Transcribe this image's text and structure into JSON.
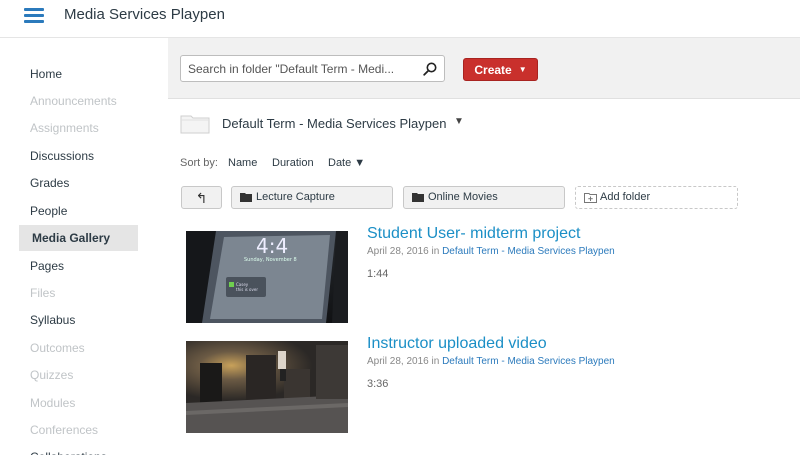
{
  "header": {
    "title": "Media Services Playpen"
  },
  "sidebar": {
    "items": [
      {
        "label": "Home",
        "state": "enabled"
      },
      {
        "label": "Announcements",
        "state": "disabled"
      },
      {
        "label": "Assignments",
        "state": "disabled"
      },
      {
        "label": "Discussions",
        "state": "enabled"
      },
      {
        "label": "Grades",
        "state": "enabled"
      },
      {
        "label": "People",
        "state": "enabled"
      },
      {
        "label": "Media Gallery",
        "state": "active"
      },
      {
        "label": "Pages",
        "state": "enabled"
      },
      {
        "label": "Files",
        "state": "disabled"
      },
      {
        "label": "Syllabus",
        "state": "enabled"
      },
      {
        "label": "Outcomes",
        "state": "disabled"
      },
      {
        "label": "Quizzes",
        "state": "disabled"
      },
      {
        "label": "Modules",
        "state": "disabled"
      },
      {
        "label": "Conferences",
        "state": "disabled"
      },
      {
        "label": "Collaborations",
        "state": "enabled"
      }
    ]
  },
  "toolbar": {
    "search_value": "Search in folder \"Default Term - Medi...",
    "create_label": "Create",
    "create_caret": "▼"
  },
  "folder": {
    "title": "Default Term - Media Services Playpen",
    "dropdown_caret": "▼"
  },
  "sort": {
    "label": "Sort by:",
    "options": [
      {
        "label": "Name"
      },
      {
        "label": "Duration"
      },
      {
        "label": "Date ▼"
      }
    ]
  },
  "folders": {
    "up_symbol": "↰",
    "items": [
      {
        "label": "Lecture Capture"
      },
      {
        "label": "Online Movies"
      }
    ],
    "add_label": "Add folder"
  },
  "media": [
    {
      "title": "Student User- midterm project",
      "date": "April 28, 2016",
      "in_word": "in",
      "folder": "Default Term - Media Services Playpen",
      "duration": "1:44",
      "thumb_text": {
        "time": "4:4",
        "date": "Sunday, November 8",
        "notif": "Casey\nthis is over"
      }
    },
    {
      "title": "Instructor uploaded video",
      "date": "April 28, 2016",
      "in_word": "in",
      "folder": "Default Term - Media Services Playpen",
      "duration": "3:36"
    }
  ],
  "colors": {
    "accent_blue": "#2b7abc",
    "link_title": "#1b8fc6",
    "create_red": "#c9302c",
    "disabled_text": "#c0c4c7"
  }
}
